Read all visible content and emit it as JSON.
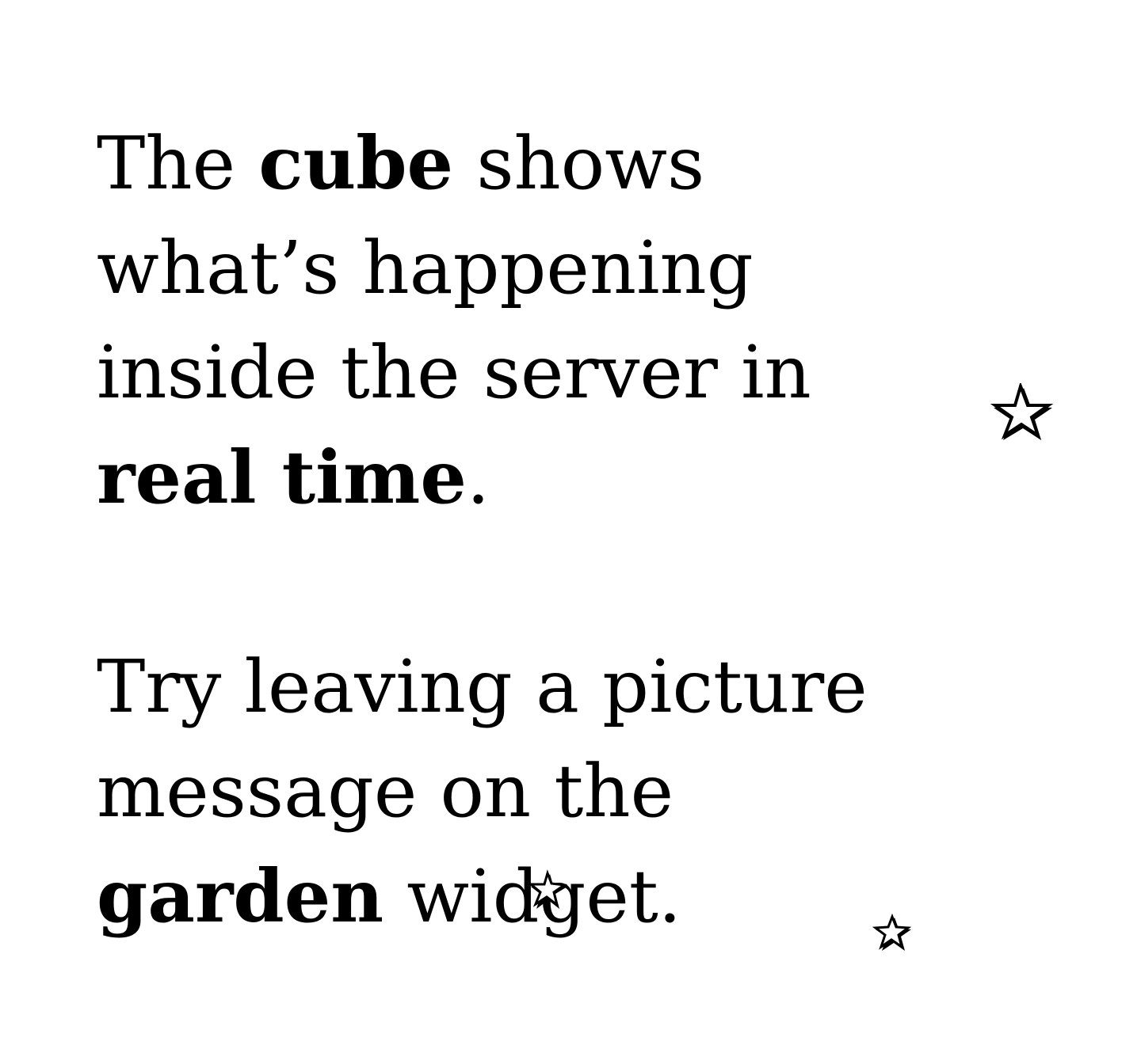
{
  "paragraph1": {
    "t1": "The ",
    "b1": "cube",
    "t2": " shows what’s happening inside the server in ",
    "b2": "real time",
    "t3": "."
  },
  "paragraph2": {
    "t1": "Try leaving a picture message on the ",
    "b1": "garden",
    "t2": " widget."
  },
  "decorations": {
    "icons": [
      "star-icon",
      "star-icon",
      "star-icon"
    ],
    "color": "#000000",
    "background": "#ffffff"
  }
}
